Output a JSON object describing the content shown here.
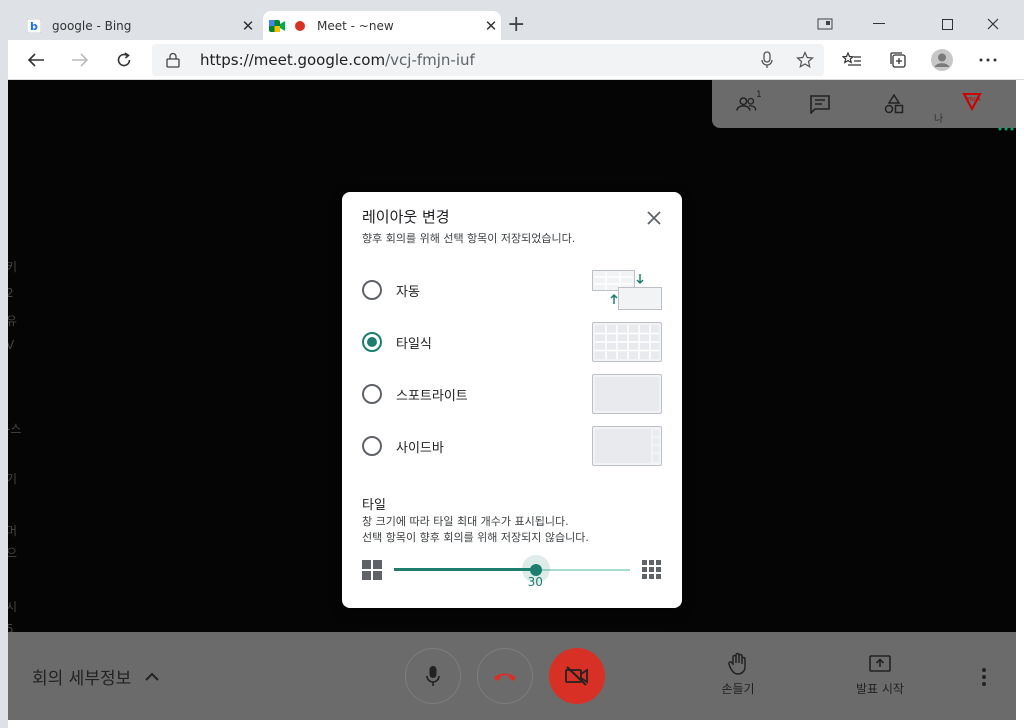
{
  "browser": {
    "tabs": [
      {
        "title": "google - Bing",
        "icon": "bing-icon"
      },
      {
        "title": "Meet - ~new",
        "icon": "meet-icon"
      }
    ],
    "new_tab": "+",
    "url_host": "https://meet.google.com",
    "url_path": "/vcj-fmjn-iuf"
  },
  "meet": {
    "participants_count": "1",
    "me_label": "나",
    "details_label": "회의 세부정보",
    "raise_hand_label": "손들기",
    "present_label": "발표 시작",
    "accent_color": "#1e7e6e",
    "end_call_color": "#d93025"
  },
  "background_fragments": [
    "키",
    "2",
    "유",
    "V",
    "-스",
    "기",
    "머",
    "으",
    "시",
    "5"
  ],
  "dialog": {
    "title": "레이아웃 변경",
    "subtitle": "향후 회의를 위해 선택 항목이 저장되었습니다.",
    "options": [
      {
        "label": "자동",
        "selected": false
      },
      {
        "label": "타일식",
        "selected": true
      },
      {
        "label": "스포트라이트",
        "selected": false
      },
      {
        "label": "사이드바",
        "selected": false
      }
    ],
    "tile_section_title": "타일",
    "tile_desc_1": "창 크기에 따라 타일 최대 개수가 표시됩니다.",
    "tile_desc_2": "선택 항목이 향후 회의를 위해 저장되지 않습니다.",
    "slider_value": "30",
    "slider_fraction": 0.6
  }
}
